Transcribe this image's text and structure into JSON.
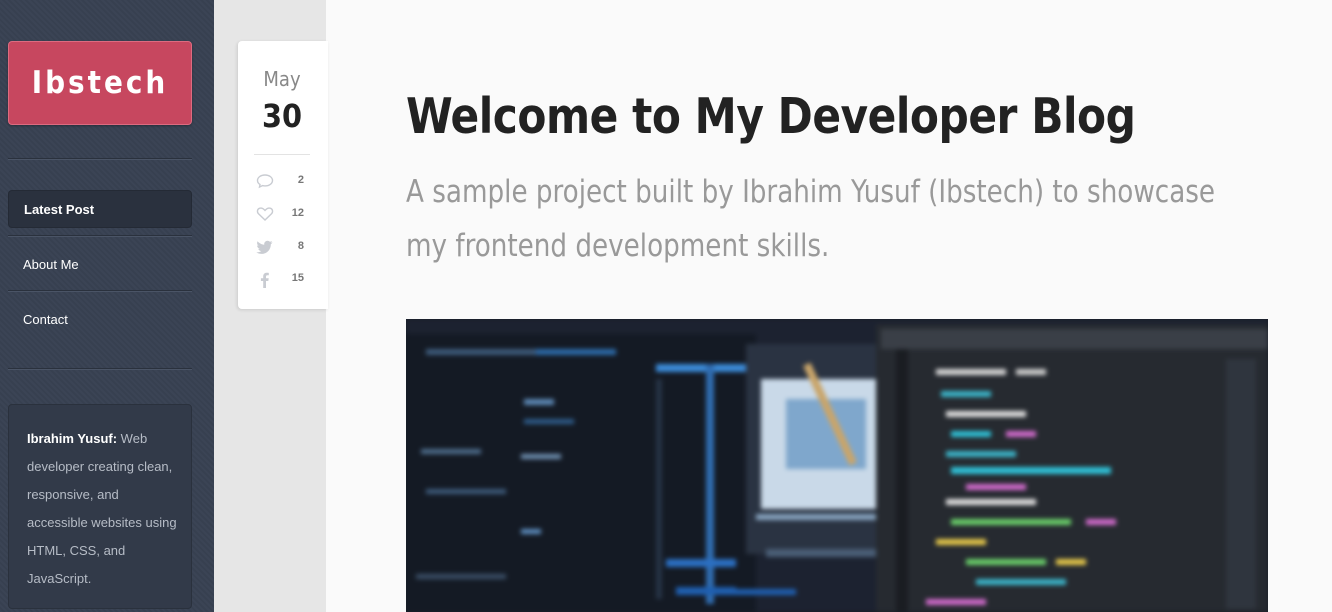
{
  "sidebar": {
    "logo": "Ibstech",
    "nav": [
      {
        "label": "Latest Post",
        "active": true
      },
      {
        "label": "About Me",
        "active": false
      },
      {
        "label": "Contact",
        "active": false
      }
    ],
    "bio": {
      "name": "Ibrahim Yusuf:",
      "text": " Web developer creating clean, responsive, and accessible websites using HTML, CSS, and JavaScript."
    }
  },
  "post": {
    "month": "May",
    "day": "30",
    "stats": {
      "comments": "2",
      "likes": "12",
      "tweets": "8",
      "facebook": "15"
    },
    "title": "Welcome to My Developer Blog",
    "subtitle": "A sample project built by Ibrahim Yusuf (Ibstech) to showcase my frontend development skills.",
    "image_alt": "blurred code on monitors"
  },
  "colors": {
    "sidebar_bg": "#384152",
    "logo_bg": "#c7475f",
    "title": "#222222",
    "subtitle": "#999999"
  },
  "icons": [
    "comment-icon",
    "heart-icon",
    "twitter-icon",
    "facebook-icon"
  ]
}
